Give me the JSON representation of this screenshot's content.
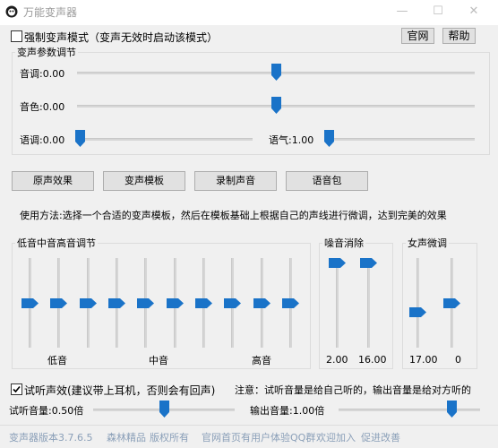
{
  "window": {
    "title": "万能变声器",
    "minimize_glyph": "—",
    "maximize_glyph": "☐",
    "close_glyph": "✕",
    "icon": "app-logo-icon"
  },
  "top": {
    "force_mode_label": "强制变声模式（变声无效时启动该模式）",
    "force_mode_checked": false,
    "official_site_button": "官网",
    "help_button": "帮助"
  },
  "params": {
    "group_title": "变声参数调节",
    "pitch_label": "音调:0.00",
    "pitch_value": 0.5,
    "timbre_label": "音色:0.00",
    "timbre_value": 0.5,
    "speed_label": "语调:0.00",
    "speed_value": 0.0,
    "tone_label": "语气:1.00",
    "tone_value": 0.0
  },
  "actions": {
    "original": "原声效果",
    "template": "变声模板",
    "record": "录制声音",
    "voice_pack": "语音包"
  },
  "usage_text": "使用方法:选择一个合适的变声模板，然后在模板基础上根据自己的声线进行微调，达到完美的效果",
  "eq": {
    "group_title": "低音中音高音调节",
    "levels": [
      0.5,
      0.5,
      0.5,
      0.5,
      0.5,
      0.5,
      0.5,
      0.5,
      0.5,
      0.5
    ],
    "low_label": "低音",
    "mid_label": "中音",
    "high_label": "高音"
  },
  "noise": {
    "group_title": "噪音消除",
    "levels": [
      0.0,
      0.0
    ],
    "value1": "2.00",
    "value2": "16.00"
  },
  "female": {
    "group_title": "女声微调",
    "levels": [
      0.62,
      0.5
    ],
    "value1": "17.00",
    "value2": "0"
  },
  "listen": {
    "test_label": "试听声效(建议带上耳机，否则会有回声)",
    "test_checked": true,
    "note": "注意：试听音量是给自己听的，输出音量是给对方听的",
    "listen_volume_label": "试听音量:0.50倍",
    "listen_volume": 0.5,
    "output_volume_label": "输出音量:1.00倍",
    "output_volume": 0.82
  },
  "status": {
    "version": "变声器版本3.7.6.5",
    "brand": "森林精品",
    "copyright": "版权所有",
    "user_group": "官网首页有用户体验QQ群",
    "welcome": "欢迎加入",
    "improve": "促进改善"
  },
  "colors": {
    "thumb": "#1a73c8",
    "status_text": "#8a9fb8",
    "title_text": "#9a9a9a"
  }
}
